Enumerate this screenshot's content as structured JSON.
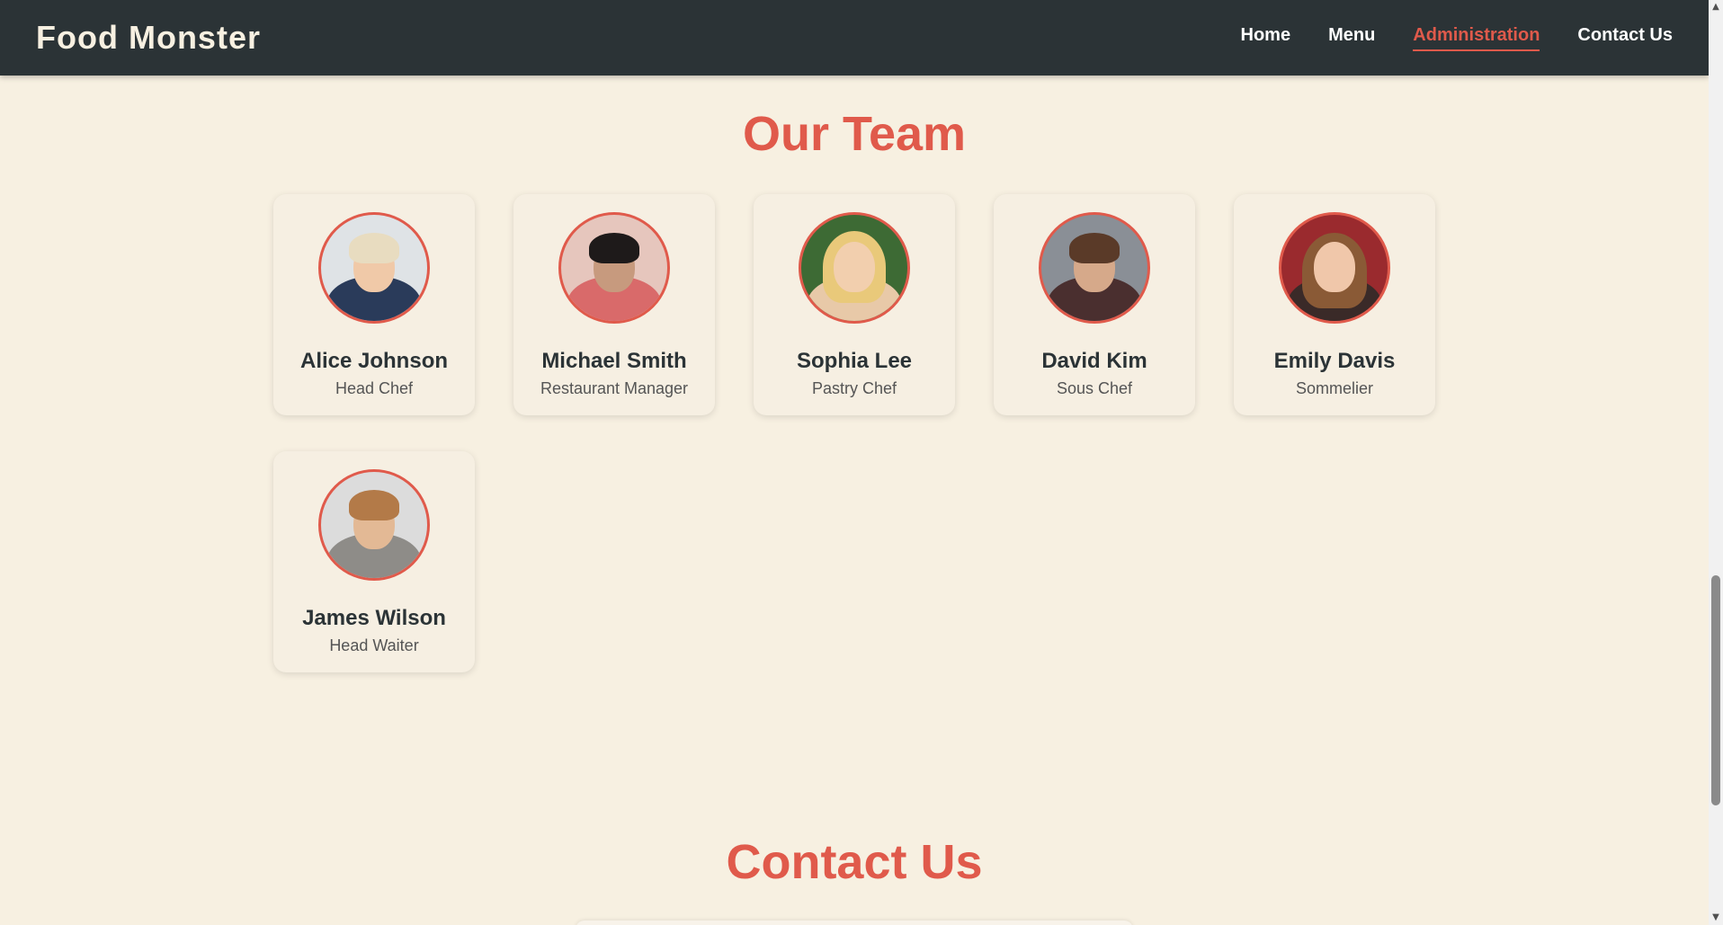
{
  "navbar": {
    "brand": "Food Monster",
    "links": [
      {
        "label": "Home",
        "active": false
      },
      {
        "label": "Menu",
        "active": false
      },
      {
        "label": "Administration",
        "active": true
      },
      {
        "label": "Contact Us",
        "active": false
      }
    ]
  },
  "team": {
    "title": "Our Team",
    "members": [
      {
        "name": "Alice Johnson",
        "role": "Head Chef",
        "avatar_icon": "portrait-photo"
      },
      {
        "name": "Michael Smith",
        "role": "Restaurant Manager",
        "avatar_icon": "portrait-photo"
      },
      {
        "name": "Sophia Lee",
        "role": "Pastry Chef",
        "avatar_icon": "portrait-photo"
      },
      {
        "name": "David Kim",
        "role": "Sous Chef",
        "avatar_icon": "portrait-photo"
      },
      {
        "name": "Emily Davis",
        "role": "Sommelier",
        "avatar_icon": "portrait-photo"
      },
      {
        "name": "James Wilson",
        "role": "Head Waiter",
        "avatar_icon": "portrait-photo"
      }
    ]
  },
  "contact": {
    "title": "Contact Us"
  },
  "colors": {
    "accent": "#e05a4b",
    "navbar_bg": "#2b3336",
    "page_bg": "#f7f0e1",
    "text_dark": "#2b3336"
  },
  "scrollbar": {
    "up_icon": "triangle-up-icon",
    "down_icon": "triangle-down-icon"
  }
}
